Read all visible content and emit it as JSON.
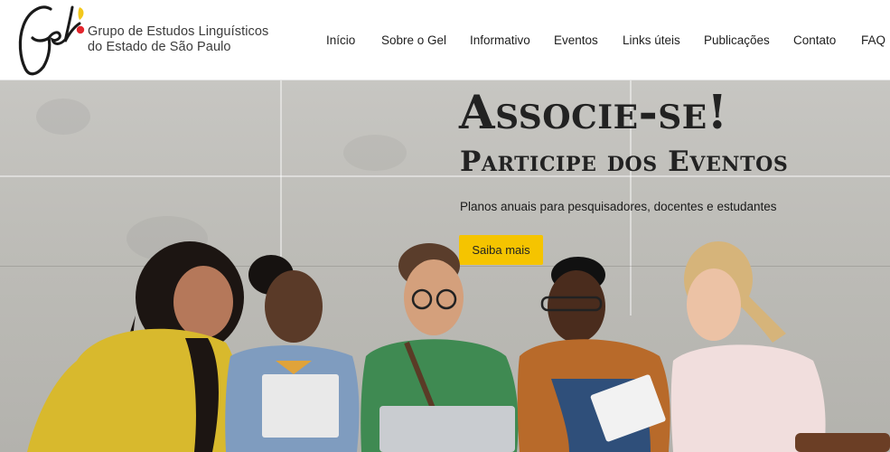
{
  "header": {
    "logo": {
      "monogram": "Gel",
      "line1": "Grupo de Estudos Linguísticos",
      "line2": "do Estado de São Paulo"
    },
    "nav": [
      {
        "id": "inicio",
        "label": "Início"
      },
      {
        "id": "sobre",
        "label": "Sobre o Gel"
      },
      {
        "id": "informativo",
        "label": "Informativo"
      },
      {
        "id": "eventos",
        "label": "Eventos"
      },
      {
        "id": "links",
        "label": "Links úteis"
      },
      {
        "id": "publicacoes",
        "label": "Publicações"
      },
      {
        "id": "contato",
        "label": "Contato"
      },
      {
        "id": "faq",
        "label": "FAQ"
      }
    ]
  },
  "hero": {
    "title": "Associe-se!",
    "subtitle": "Participe dos Eventos",
    "text": "Planos anuais para pesquisadores, docentes e estudantes",
    "button_label": "Saiba mais",
    "image_alt": "students-sitting-against-concrete-wall-photo"
  },
  "colors": {
    "accent": "#f5c400",
    "logo_red": "#e3262d",
    "logo_yellow": "#f3c81b",
    "text": "#222222",
    "header_bg": "#ffffff"
  }
}
